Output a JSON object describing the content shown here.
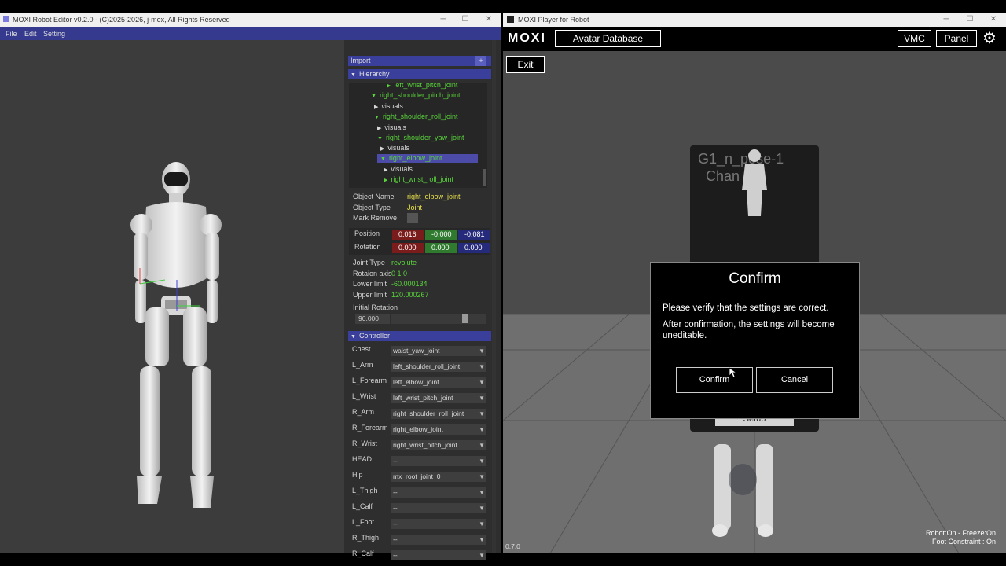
{
  "editor": {
    "title": "MOXI Robot Editor v0.2.0 - (C)2025-2026, j-mex, All Rights Reserved",
    "menu": [
      "File",
      "Edit",
      "Setting"
    ],
    "import_label": "Import",
    "import_add": "+",
    "hierarchy_label": "Hierarchy",
    "tree": [
      {
        "text": "left_wrist_pitch_joint",
        "color": "green"
      },
      {
        "text": "right_shoulder_pitch_joint",
        "color": "green"
      },
      {
        "text": "visuals",
        "color": "white"
      },
      {
        "text": "right_shoulder_roll_joint",
        "color": "green"
      },
      {
        "text": "visuals",
        "color": "white"
      },
      {
        "text": "right_shoulder_yaw_joint",
        "color": "green"
      },
      {
        "text": "visuals",
        "color": "white"
      },
      {
        "text": "right_elbow_joint",
        "color": "green"
      },
      {
        "text": "visuals",
        "color": "white"
      },
      {
        "text": "right_wrist_roll_joint",
        "color": "green"
      }
    ],
    "props": {
      "object_name_label": "Object Name",
      "object_name": "right_elbow_joint",
      "object_type_label": "Object Type",
      "object_type": "Joint",
      "mark_remove_label": "Mark Remove",
      "position_label": "Position",
      "pos": [
        "0.016",
        "-0.000",
        "-0.081"
      ],
      "rotation_label": "Rotation",
      "rot": [
        "0.000",
        "0.000",
        "0.000"
      ],
      "joint_type_label": "Joint Type",
      "joint_type": "revolute",
      "rot_axis_label": "Rotaion axis",
      "rot_axis": "0 1 0",
      "lower_label": "Lower limit",
      "lower": "-60.000134",
      "upper_label": "Upper limit",
      "upper": "120.000267",
      "init_rot_label": "Initial Rotation",
      "init_rot": "90.000",
      "init_rot_fraction": 0.8
    },
    "controller_label": "Controller",
    "controller": [
      {
        "label": "Chest",
        "value": "waist_yaw_joint"
      },
      {
        "label": "L_Arm",
        "value": "left_shoulder_roll_joint"
      },
      {
        "label": "L_Forearm",
        "value": "left_elbow_joint"
      },
      {
        "label": "L_Wrist",
        "value": "left_wrist_pitch_joint"
      },
      {
        "label": "R_Arm",
        "value": "right_shoulder_roll_joint"
      },
      {
        "label": "R_Forearm",
        "value": "right_elbow_joint"
      },
      {
        "label": "R_Wrist",
        "value": "right_wrist_pitch_joint"
      },
      {
        "label": "HEAD",
        "value": "--"
      },
      {
        "label": "Hip",
        "value": "mx_root_joint_0"
      },
      {
        "label": "L_Thigh",
        "value": "--"
      },
      {
        "label": "L_Calf",
        "value": "--"
      },
      {
        "label": "L_Foot",
        "value": "--"
      },
      {
        "label": "R_Thigh",
        "value": "--"
      },
      {
        "label": "R_Calf",
        "value": "--"
      }
    ]
  },
  "player": {
    "title": "MOXI Player for Robot",
    "logo": "MOXI",
    "avatar_db": "Avatar Database",
    "vmc": "VMC",
    "panel": "Panel",
    "exit": "Exit",
    "card_line1": "G1_n_pose-1",
    "card_line2": "Chan   0",
    "setup": "Setup",
    "version": "0.7.0",
    "status1": "Robot:On - Freeze:On",
    "status2": "Foot Constraint : On"
  },
  "dialog": {
    "title": "Confirm",
    "line1": "Please verify that the settings are correct.",
    "line2": "After confirmation, the settings will become uneditable.",
    "confirm": "Confirm",
    "cancel": "Cancel"
  },
  "colors": {
    "accent": "#3a3f9c",
    "pos_x": "#7a1c1c",
    "pos_y": "#2f7a2f",
    "pos_z": "#262a7a"
  }
}
